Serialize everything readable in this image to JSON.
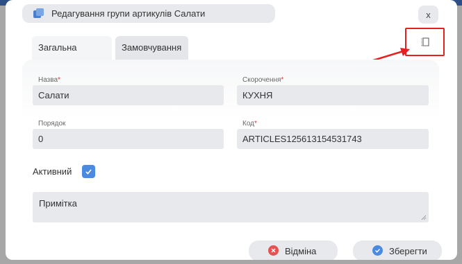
{
  "dialog": {
    "title": "Редагування групи артикулів Салати",
    "close_label": "x"
  },
  "tabs": [
    {
      "label": "Загальна"
    },
    {
      "label": "Замовчування"
    }
  ],
  "form": {
    "name_label": "Назва",
    "name_value": "Салати",
    "short_label": "Скорочення",
    "short_value": "КУХНЯ",
    "order_label": "Порядок",
    "order_value": "0",
    "code_label": "Код",
    "code_value": "ARTICLES125613154531743",
    "required_mark": "*",
    "active_label": "Активний",
    "active_checked": true,
    "notes_placeholder": "Примітка"
  },
  "buttons": {
    "cancel_label": "Відміна",
    "save_label": "Зберегти"
  },
  "colors": {
    "accent": "#4a8ae0",
    "cancel": "#e45252",
    "highlight": "#e52020"
  }
}
